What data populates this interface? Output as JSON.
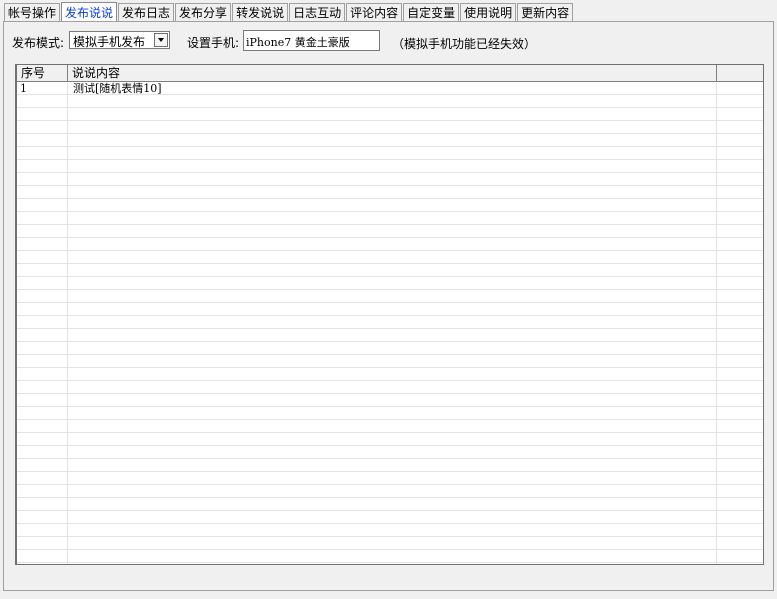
{
  "tabs": [
    {
      "label": "帐号操作",
      "active": false
    },
    {
      "label": "发布说说",
      "active": true
    },
    {
      "label": "发布日志",
      "active": false
    },
    {
      "label": "发布分享",
      "active": false
    },
    {
      "label": "转发说说",
      "active": false
    },
    {
      "label": "日志互动",
      "active": false
    },
    {
      "label": "评论内容",
      "active": false
    },
    {
      "label": "自定变量",
      "active": false
    },
    {
      "label": "使用说明",
      "active": false
    },
    {
      "label": "更新内容",
      "active": false
    }
  ],
  "toolbar": {
    "mode_label": "发布模式:",
    "mode_value": "模拟手机发布",
    "phone_label": "设置手机:",
    "phone_value": "iPhone7 黄金土豪版",
    "note": "（模拟手机功能已经失效）"
  },
  "table": {
    "columns": [
      "序号",
      "说说内容",
      ""
    ],
    "rows": [
      {
        "no": "1",
        "content": "测试[随机表情10]"
      }
    ]
  },
  "colors": {
    "active_tab_text": "#0a3fd6",
    "window_bg": "#f0f0f0"
  }
}
